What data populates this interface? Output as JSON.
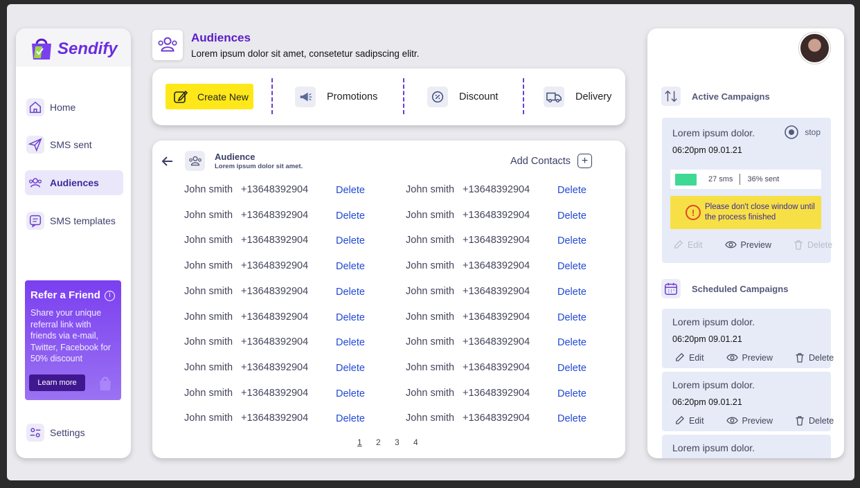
{
  "brand": {
    "name": "Sendify"
  },
  "sidebar": {
    "items": [
      {
        "label": "Home"
      },
      {
        "label": "SMS sent"
      },
      {
        "label": "Audiences"
      },
      {
        "label": "SMS templates"
      }
    ],
    "settings_label": "Settings",
    "refer": {
      "title": "Refer a Friend",
      "text": "Share your unique referral link with friends via e-mail, Twitter, Facebook for 50% discount",
      "button": "Learn more"
    }
  },
  "header": {
    "title": "Audiences",
    "subtitle": "Lorem ipsum dolor sit amet, consetetur sadipscing elitr."
  },
  "toolbar": {
    "create_label": "Create New",
    "promotions_label": "Promotions",
    "discount_label": "Discount",
    "delivery_label": "Delivery"
  },
  "audience": {
    "title": "Audience",
    "subtitle": "Lorem ipsum dolor sit amet.",
    "add_contacts_label": "Add Contacts",
    "delete_label": "Delete",
    "contacts": [
      {
        "name": "John smith",
        "phone": "+13648392904"
      },
      {
        "name": "John smith",
        "phone": "+13648392904"
      },
      {
        "name": "John smith",
        "phone": "+13648392904"
      },
      {
        "name": "John smith",
        "phone": "+13648392904"
      },
      {
        "name": "John smith",
        "phone": "+13648392904"
      },
      {
        "name": "John smith",
        "phone": "+13648392904"
      },
      {
        "name": "John smith",
        "phone": "+13648392904"
      },
      {
        "name": "John smith",
        "phone": "+13648392904"
      },
      {
        "name": "John smith",
        "phone": "+13648392904"
      },
      {
        "name": "John smith",
        "phone": "+13648392904"
      },
      {
        "name": "John smith",
        "phone": "+13648392904"
      },
      {
        "name": "John smith",
        "phone": "+13648392904"
      },
      {
        "name": "John smith",
        "phone": "+13648392904"
      },
      {
        "name": "John smith",
        "phone": "+13648392904"
      },
      {
        "name": "John smith",
        "phone": "+13648392904"
      },
      {
        "name": "John smith",
        "phone": "+13648392904"
      },
      {
        "name": "John smith",
        "phone": "+13648392904"
      },
      {
        "name": "John smith",
        "phone": "+13648392904"
      },
      {
        "name": "John smith",
        "phone": "+13648392904"
      },
      {
        "name": "John smith",
        "phone": "+13648392904"
      }
    ],
    "pages": [
      "1",
      "2",
      "3",
      "4"
    ],
    "current_page": "1"
  },
  "active": {
    "title": "Active Campaigns",
    "campaign": {
      "title": "Lorem ipsum dolor.",
      "time": "06:20pm 09.01.21",
      "stop_label": "stop",
      "sms_count": "27 sms",
      "sent_pct": "36% sent",
      "progress": 0.36,
      "warning": "Please don't close window until the process finished",
      "edit_label": "Edit",
      "preview_label": "Preview",
      "delete_label": "Delete"
    }
  },
  "scheduled": {
    "title": "Scheduled Campaigns",
    "campaigns": [
      {
        "title": "Lorem ipsum dolor.",
        "time": "06:20pm 09.01.21",
        "edit_label": "Edit",
        "preview_label": "Preview",
        "delete_label": "Delete"
      },
      {
        "title": "Lorem ipsum dolor.",
        "time": "06:20pm 09.01.21",
        "edit_label": "Edit",
        "preview_label": "Preview",
        "delete_label": "Delete"
      },
      {
        "title": "Lorem ipsum dolor."
      }
    ]
  },
  "colors": {
    "brand": "#6a2ce0",
    "accent_yellow": "#ffe81a",
    "link_blue": "#2148d6",
    "progress_green": "#3fd995"
  }
}
